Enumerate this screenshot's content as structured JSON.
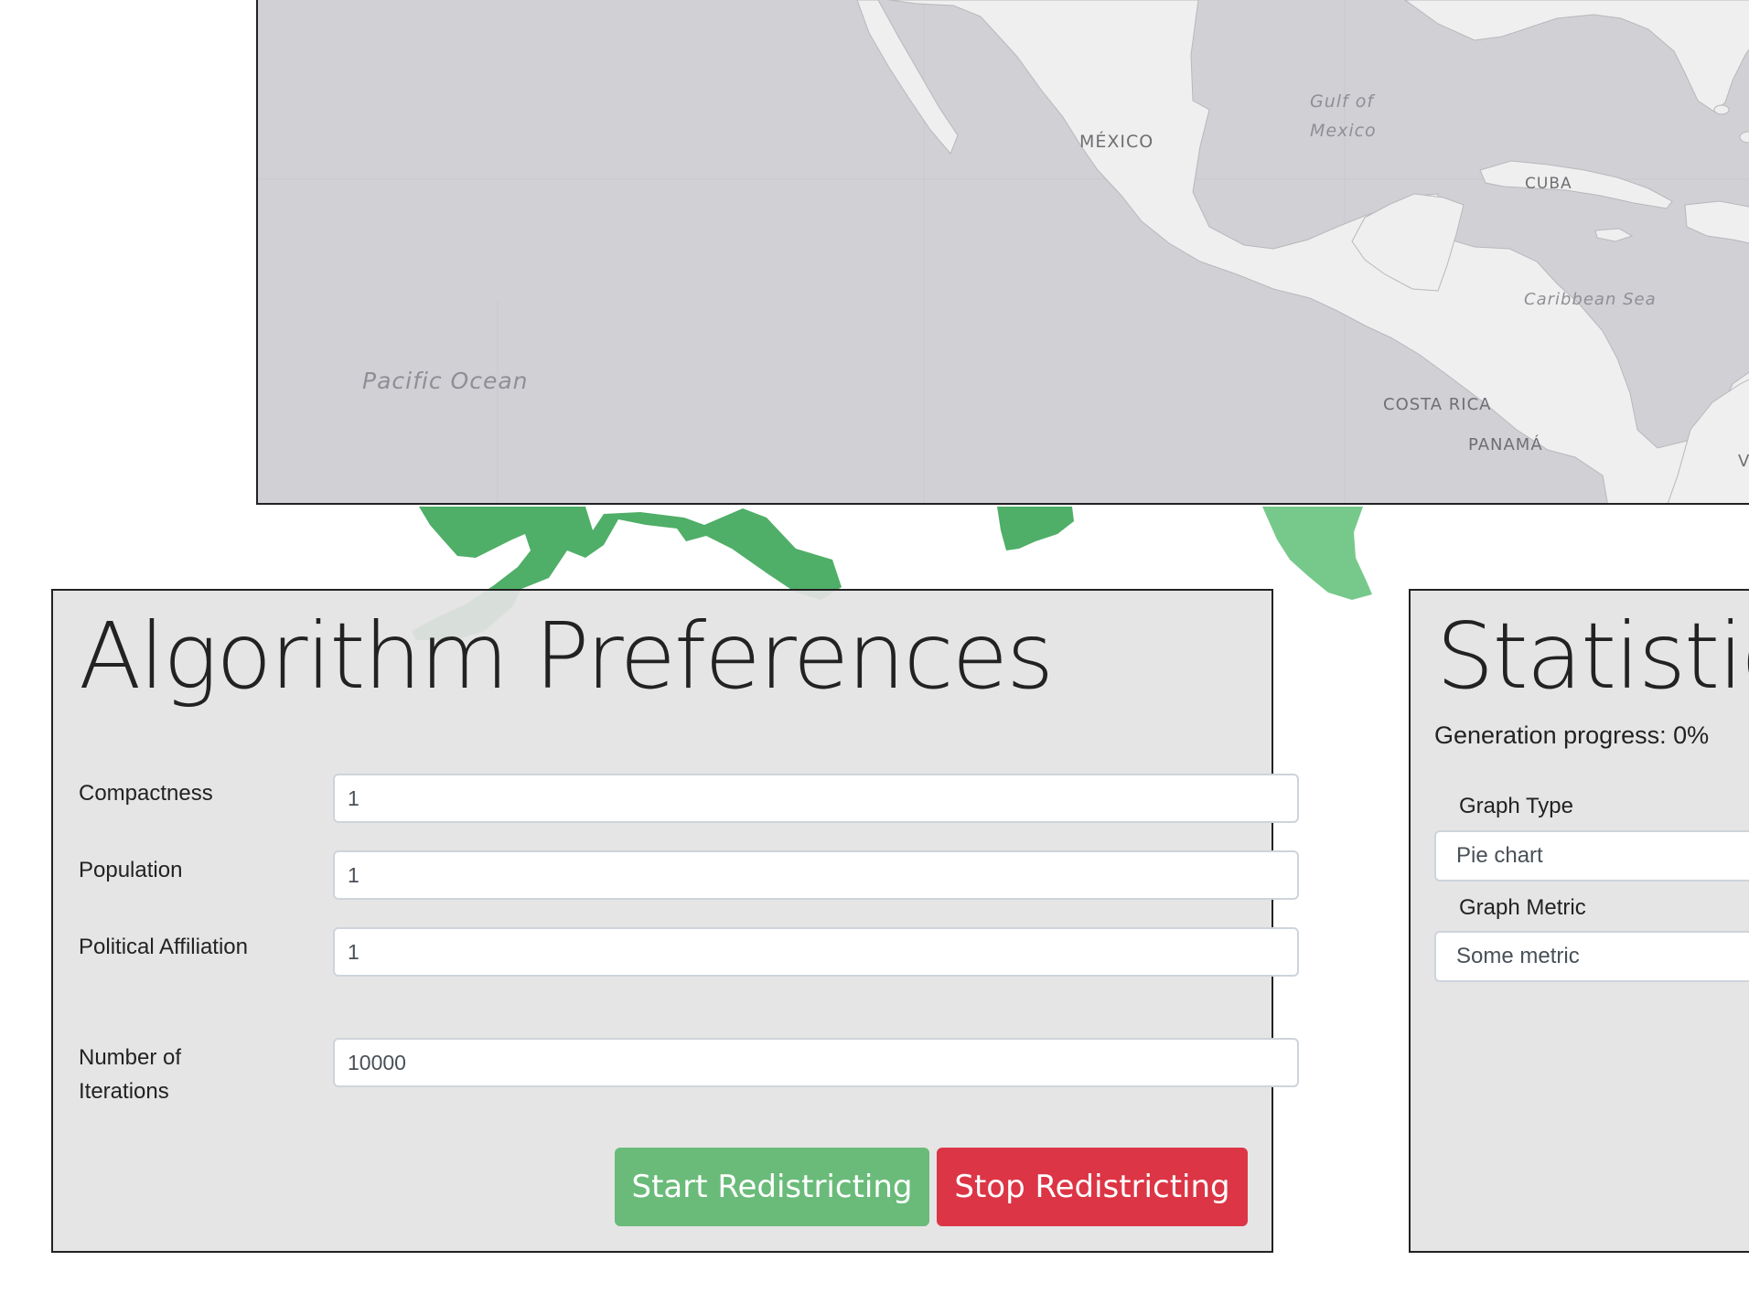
{
  "map": {
    "labels": {
      "mexico": "MÉXICO",
      "gulf_line1": "Gulf of",
      "gulf_line2": "Mexico",
      "cuba": "CUBA",
      "caribbean": "Caribbean Sea",
      "pacific": "Pacific Ocean",
      "costa_rica": "COSTA RICA",
      "panama": "PANAMÁ",
      "edge_letter": "V"
    },
    "colors": {
      "water": "#d1d0d5",
      "land": "#efefef",
      "district_dark": "#4fae67",
      "district_light": "#76c98a"
    }
  },
  "preferences": {
    "title": "Algorithm Preferences",
    "fields": [
      {
        "label": "Compactness",
        "value": "1"
      },
      {
        "label": "Population",
        "value": "1"
      },
      {
        "label": "Political Affiliation",
        "value": "1"
      },
      {
        "label": "Number of Iterations",
        "value": "10000"
      }
    ],
    "start_label": "Start Redistricting",
    "stop_label": "Stop Redistricting",
    "colors": {
      "start": "#6abb79",
      "stop": "#dc3545"
    }
  },
  "statistics": {
    "title": "Statistics",
    "progress_text": "Generation progress: 0%",
    "graph_type_label": "Graph Type",
    "graph_type_value": "Pie chart",
    "graph_metric_label": "Graph Metric",
    "graph_metric_value": "Some metric"
  }
}
